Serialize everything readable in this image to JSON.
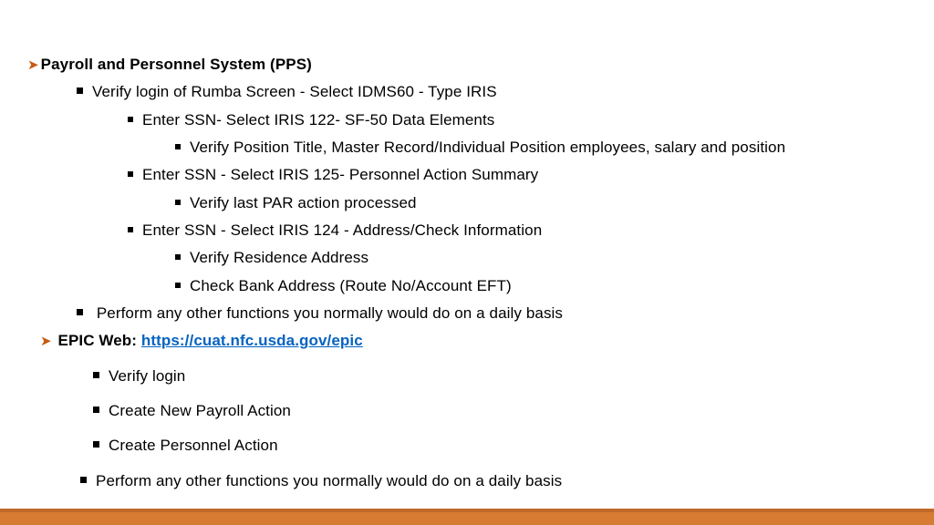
{
  "section1": {
    "title": "Payroll and Personnel System (PPS)",
    "l1": "Verify login of Rumba Screen - Select IDMS60  - Type IRIS",
    "l2": "Enter SSN- Select IRIS 122- SF-50 Data Elements",
    "l3": "Verify Position Title, Master Record/Individual Position  employees, salary and position",
    "l4": "Enter SSN - Select IRIS 125- Personnel Action Summary",
    "l5": "Verify last PAR action processed",
    "l6": "Enter SSN - Select IRIS 124 - Address/Check Information",
    "l7": "Verify Residence Address",
    "l8": "Check Bank Address (Route No/Account EFT)",
    "l9": " Perform any other functions you normally would do on a daily basis"
  },
  "section2": {
    "prefix": "EPIC Web:  ",
    "url": "https://cuat.nfc.usda.gov/epic",
    "e1": "Verify login",
    "e2": "Create New Payroll Action",
    "e3": "Create Personnel Action",
    "e4": "Perform any other functions you normally would do on a daily basis"
  }
}
